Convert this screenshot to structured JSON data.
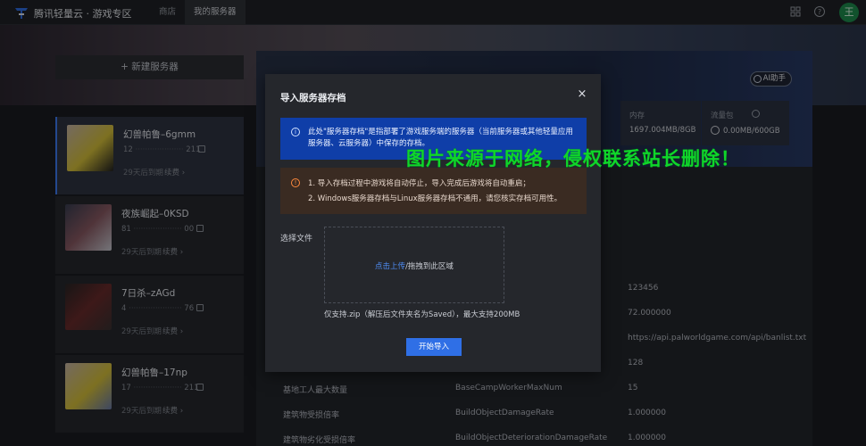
{
  "app": {
    "brand": "腾讯轻量云 · 游戏专区",
    "nav": {
      "store": "商店",
      "my_servers": "我的服务器"
    },
    "avatar_initial": "王",
    "icons": {
      "apps": "grid-icon",
      "help": "help-icon"
    }
  },
  "sidebar": {
    "new_server": "+ 新建服务器",
    "cards": [
      {
        "name": "幻兽帕鲁–6gmm",
        "ip_start": "12",
        "ip_end": "211",
        "expire": "29天后到期",
        "renew": "续费 ›"
      },
      {
        "name": "夜族崛起–0KSD",
        "ip_start": "81",
        "ip_end": "00",
        "expire": "29天后到期",
        "renew": "续费 ›"
      },
      {
        "name": "7日杀–zAGd",
        "ip_start": "4",
        "ip_end": "76",
        "expire": "29天后到期",
        "renew": "续费 ›"
      },
      {
        "name": "幻兽帕鲁–17np",
        "ip_start": "17",
        "ip_end": "211",
        "expire": "29天后到期",
        "renew": "续费 ›"
      }
    ]
  },
  "main": {
    "ai_button": "AI助手",
    "stats": [
      {
        "label": "内存",
        "value": "1697.004MB/8GB"
      },
      {
        "label": "流量包",
        "value": "0.00MB/600GB"
      }
    ],
    "rows": [
      {
        "label": "",
        "key": "",
        "value": "123456"
      },
      {
        "label": "",
        "key": "",
        "value": "72.000000"
      },
      {
        "label": "",
        "key": "",
        "value": "https://api.palworldgame.com/api/banlist.txt"
      },
      {
        "label": "",
        "key": "",
        "value": "128"
      },
      {
        "label": "基地工人最大数量",
        "key": "BaseCampWorkerMaxNum",
        "value": "15"
      },
      {
        "label": "建筑物受损倍率",
        "key": "BuildObjectDamageRate",
        "value": "1.000000"
      },
      {
        "label": "建筑物劣化受损倍率",
        "key": "BuildObjectDeteriorationDamageRate",
        "value": "1.000000"
      }
    ]
  },
  "modal": {
    "title": "导入服务器存档",
    "close": "×",
    "info": "此处\"服务器存档\"是指部署了游戏服务端的服务器（当前服务器或其他轻量应用服务器、云服务器）中保存的存档。",
    "warnings": [
      "1. 导入存档过程中游戏将自动停止，导入完成后游戏将自动重启；",
      "2. Windows服务器存档与Linux服务器存档不通用，请您核实存档可用性。"
    ],
    "file_label": "选择文件",
    "drop_link": "点击上传",
    "drop_text": "/拖拽到此区域",
    "hint": "仅支持.zip（解压后文件夹名为Saved），最大支持200MB",
    "start_button": "开始导入"
  },
  "watermark": "图片来源于网络，侵权联系站长删除！",
  "colors": {
    "accent": "#2f6fe6",
    "info_bg": "#0f3ea8",
    "warn_bg": "#3a2b22",
    "watermark": "#0fd62a"
  }
}
